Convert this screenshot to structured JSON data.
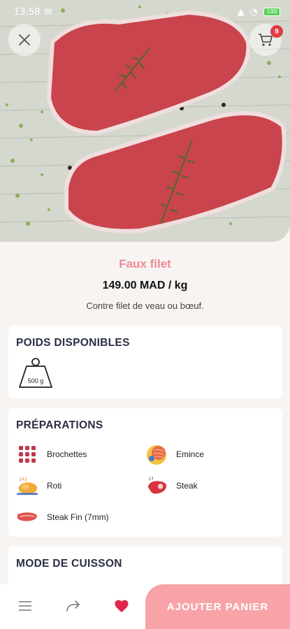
{
  "status_bar": {
    "time": "13:58",
    "battery": "100"
  },
  "cart": {
    "count": "9"
  },
  "product": {
    "name": "Faux filet",
    "price": "149.00 MAD / kg",
    "description": "Contre filet de veau ou bœuf."
  },
  "weights": {
    "title": "POIDS DISPONIBLES",
    "options": [
      {
        "label": "500 g"
      }
    ]
  },
  "preparations": {
    "title": "PRÉPARATIONS",
    "items": [
      {
        "label": "Brochettes",
        "icon": "skewers-icon"
      },
      {
        "label": "Emince",
        "icon": "minced-meat-icon"
      },
      {
        "label": "Roti",
        "icon": "roast-chicken-icon"
      },
      {
        "label": "Steak",
        "icon": "steak-icon"
      },
      {
        "label": "Steak Fin (7mm)",
        "icon": "thin-steak-icon"
      }
    ]
  },
  "cooking": {
    "title": "MODE DE CUISSON"
  },
  "bottom_bar": {
    "icons": [
      "menu-icon",
      "share-icon",
      "heart-icon"
    ],
    "add_label": "AJOUTER PANIER"
  },
  "colors": {
    "accent": "#f7a3a8",
    "title_pink": "#f08a95",
    "heart": "#e2264d",
    "badge": "#e23b45"
  }
}
